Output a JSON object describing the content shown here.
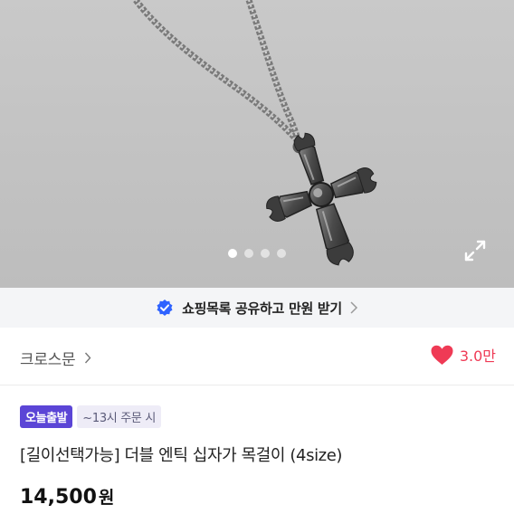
{
  "carousel": {
    "image_alt_icon": "cross-pendant-necklace",
    "dots": [
      {
        "active": true
      },
      {
        "active": false
      },
      {
        "active": false
      },
      {
        "active": false
      }
    ],
    "expand_icon": "expand-icon"
  },
  "share": {
    "icon": "verified-check-icon",
    "label": "쇼핑목록 공유하고 만원 받기",
    "accent": "#2f63ff"
  },
  "store": {
    "name": "크로스문",
    "likes": "3.0만",
    "like_color": "#ef3a55"
  },
  "badges": {
    "today_shipping": "오늘출발",
    "cutoff": "~13시 주문 시",
    "today_color": "#5b45d6"
  },
  "product": {
    "title": "[길이선택가능] 더블 엔틱 십자가 목걸이 (4size)",
    "price": "14,500",
    "currency": "원"
  }
}
